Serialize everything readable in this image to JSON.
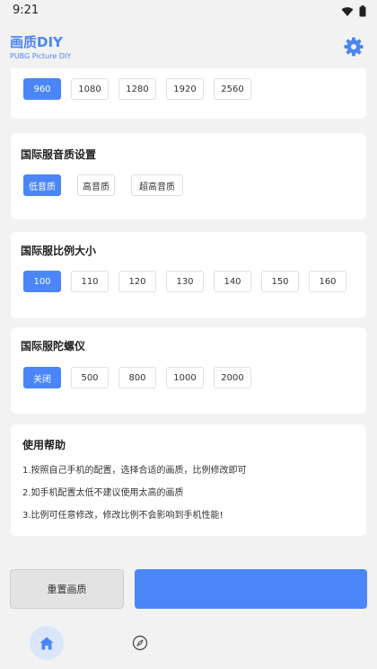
{
  "status_bar": {
    "time": "9:21",
    "icons": [
      "wifi-icon",
      "battery-icon"
    ]
  },
  "header": {
    "title": "画质DIY",
    "subtitle": "PUBG Picture DIY",
    "settings_icon": "gear-icon"
  },
  "resolution": {
    "options": [
      "960",
      "1080",
      "1280",
      "1920",
      "2560"
    ],
    "selected": "960"
  },
  "sound_quality": {
    "title": "国际服音质设置",
    "options": [
      "低音质",
      "高音质",
      "超高音质"
    ],
    "selected": "低音质"
  },
  "scale": {
    "title": "国际服比例大小",
    "options": [
      "100",
      "110",
      "120",
      "130",
      "140",
      "150",
      "160"
    ],
    "selected": "100"
  },
  "gyroscope": {
    "title": "国际服陀螺仪",
    "options": [
      "关闭",
      "500",
      "800",
      "1000",
      "2000"
    ],
    "selected": "关闭"
  },
  "help": {
    "title": "使用帮助",
    "lines": [
      "1.按照自己手机的配置，选择合适的画质，比例修改即可",
      "2.如手机配置太低不建议使用太高的画质",
      "3.比例可任意修改，修改比例不会影响到手机性能!"
    ]
  },
  "actions": {
    "reset_label": "重置画质",
    "apply_label": ""
  },
  "nav": {
    "home_icon": "home-icon",
    "explore_icon": "compass-icon"
  },
  "colors": {
    "accent": "#4a86f7",
    "background": "#f2f2f2",
    "card": "#ffffff",
    "reset_button": "#e3e3e3"
  }
}
